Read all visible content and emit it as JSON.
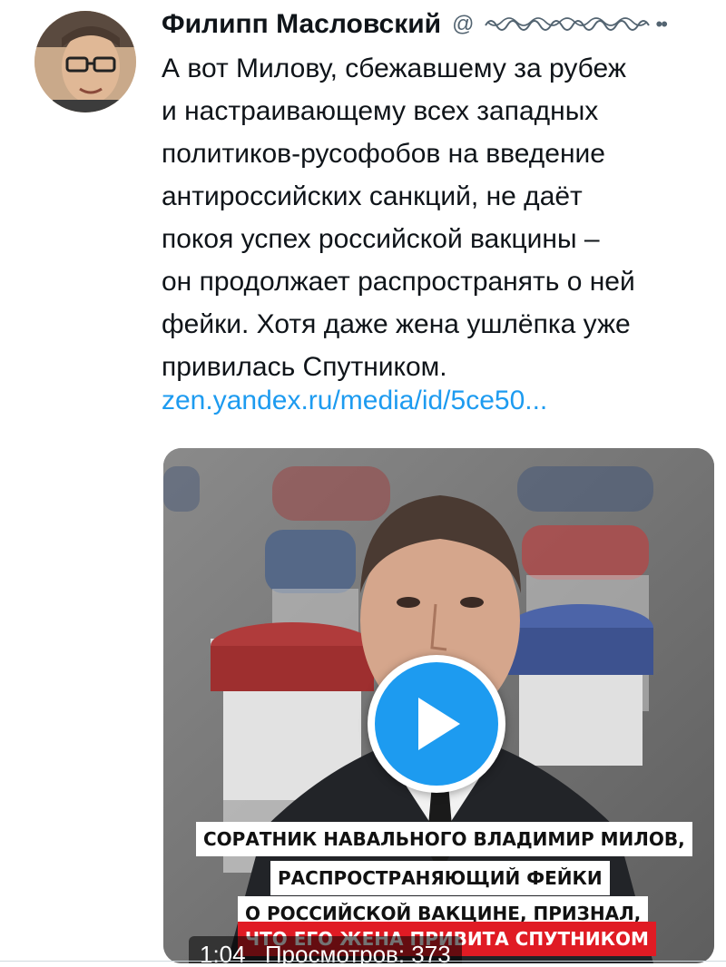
{
  "tweet": {
    "author_name": "Филипп Масловский",
    "handle_at": "@",
    "more_icon": "more-horizontal-icon",
    "text_lines": [
      "А вот Милову, сбежавшему за рубеж",
      "и настраивающему всех западных",
      "политиков-русофобов на введение",
      "антироссийских санкций, не даёт",
      "покоя успех российской вакцины –",
      "он продолжает распространять о ней",
      "фейки. Хотя даже жена ушлёпка уже",
      "привилась Спутником."
    ],
    "link": "zen.yandex.ru/media/id/5ce50..."
  },
  "video": {
    "captions": [
      "СОРАТНИК НАВАЛЬНОГО ВЛАДИМИР МИЛОВ,",
      "РАСПРОСТРАНЯЮЩИЙ ФЕЙКИ",
      "О РОССИЙСКОЙ ВАКЦИНЕ, ПРИЗНАЛ,",
      "ЧТО ЕГО ЖЕНА ПРИВИТА СПУТНИКОМ"
    ],
    "duration": "1:04",
    "views": "Просмотров: 373",
    "play_icon": "play-icon"
  },
  "colors": {
    "link": "#1d9bf0",
    "play_button": "#1d9bf0",
    "caption_red": "#e01b24",
    "text": "#0f1419"
  }
}
